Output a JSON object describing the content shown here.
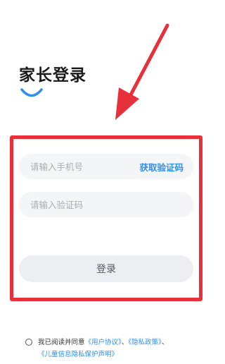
{
  "header": {
    "title": "家长登录"
  },
  "form": {
    "phone_placeholder": "请输入手机号",
    "get_code_label": "获取验证码",
    "code_placeholder": "请输入验证码",
    "login_label": "登录"
  },
  "agreement": {
    "prefix": "我已阅读并同意",
    "user_agreement": "《用户协议》",
    "separator1": "、",
    "privacy_policy": "《隐私政策》",
    "separator2": "、",
    "child_privacy": "《儿童信息隐私保护声明》"
  },
  "colors": {
    "accent": "#2f8ff0",
    "highlight": "#e8303a",
    "field_bg": "#f4f5f7",
    "button_bg": "#eceef1"
  },
  "icons": {
    "smile": "smile-arc-icon",
    "arrow": "red-arrow-annotation",
    "radio": "radio-unchecked-icon"
  }
}
